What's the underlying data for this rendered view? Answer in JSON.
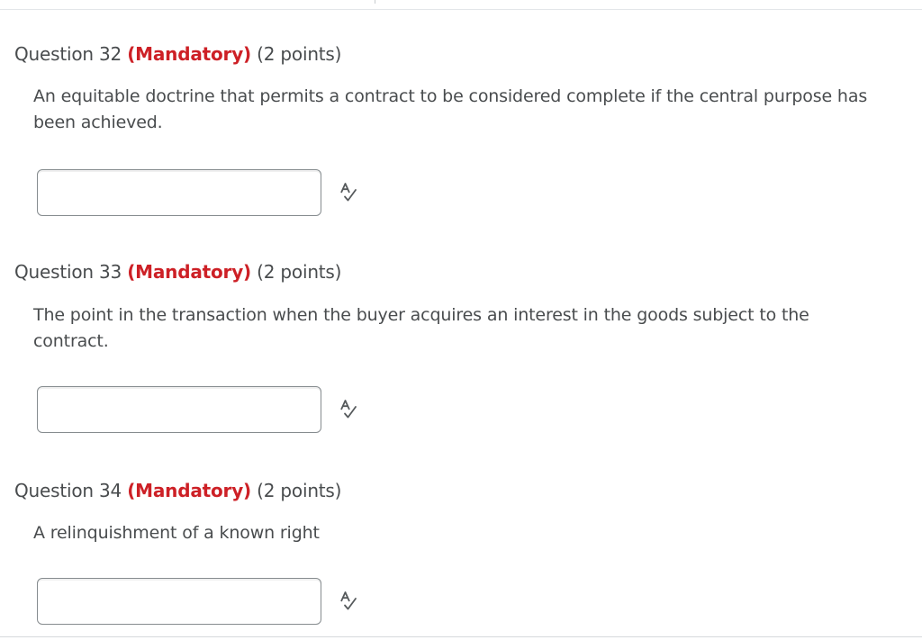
{
  "questions": [
    {
      "title": "Question 32",
      "mandatory": "(Mandatory)",
      "points": "(2 points)",
      "text": "An equitable doctrine that permits a contract to be considered complete if the central purpose has been achieved.",
      "answer_value": "",
      "spell_icon": "spellcheck-icon"
    },
    {
      "title": "Question 33",
      "mandatory": "(Mandatory)",
      "points": "(2 points)",
      "text": "The point in the transaction when the buyer acquires an interest in the goods subject to the contract.",
      "answer_value": "",
      "spell_icon": "spellcheck-icon"
    },
    {
      "title": "Question 34",
      "mandatory": "(Mandatory)",
      "points": "(2 points)",
      "text": "A relinquishment of a known right",
      "answer_value": "",
      "spell_icon": "spellcheck-icon"
    }
  ],
  "colors": {
    "mandatory": "#cd2026",
    "text": "#494c4e",
    "input_border": "#868c8f"
  }
}
